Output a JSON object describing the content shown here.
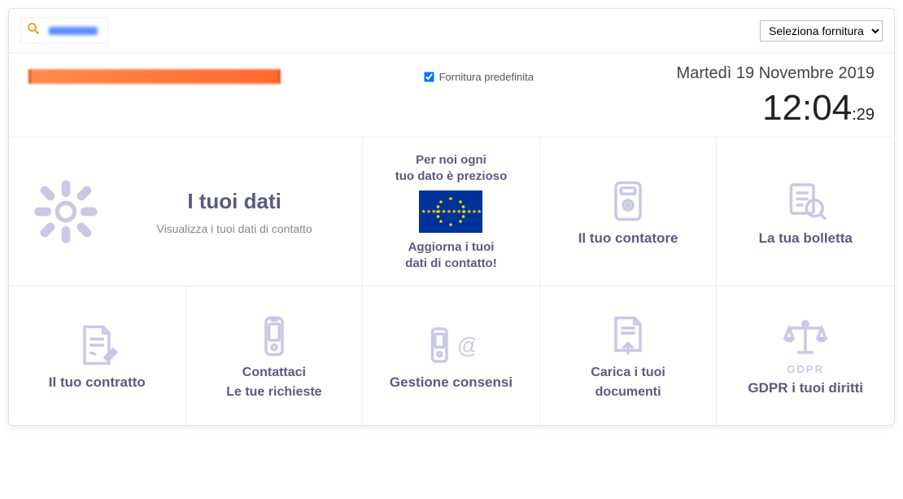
{
  "topbar": {
    "supply_select_label": "Seleziona fornitura"
  },
  "header": {
    "default_supply_label": "Fornitura predefinita",
    "date": "Martedì 19 Novembre 2019",
    "time_main": "12:04",
    "time_seconds": ":29"
  },
  "cards": {
    "user_data": {
      "title": "I tuoi dati",
      "subtitle": "Visualizza i tuoi dati di contatto"
    },
    "eu": {
      "top_line1": "Per noi ogni",
      "top_line2": "tuo dato è prezioso",
      "bot_line1": "Aggiorna i tuoi",
      "bot_line2": "dati di contatto!"
    },
    "meter": {
      "title": "Il tuo contatore"
    },
    "bill": {
      "title": "La tua bolletta"
    },
    "contract": {
      "title": "Il tuo contratto"
    },
    "contact": {
      "title_line1": "Contattaci",
      "title_line2": "Le tue richieste"
    },
    "consent": {
      "title": "Gestione consensi"
    },
    "upload": {
      "title_line1": "Carica i tuoi",
      "title_line2": "documenti"
    },
    "gdpr": {
      "label": "GDPR",
      "title": "GDPR i tuoi diritti"
    }
  }
}
